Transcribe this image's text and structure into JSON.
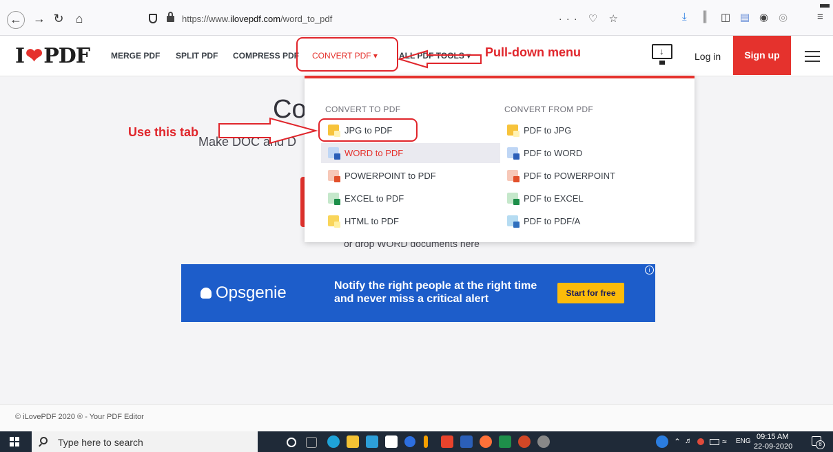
{
  "browser": {
    "url_prefix": "https://www.",
    "url_domain": "ilovepdf.com",
    "url_path": "/word_to_pdf",
    "more_icon": "···",
    "pocket_icon": "♡",
    "star_icon": "☆"
  },
  "site": {
    "logo_left": "I",
    "logo_right": "PDF",
    "menu": [
      "MERGE PDF",
      "SPLIT PDF",
      "COMPRESS PDF",
      "CONVERT PDF ▾",
      "ALL PDF TOOLS ▾"
    ],
    "login": "Log in",
    "signup": "Sign up"
  },
  "dropdown": {
    "to_heading": "CONVERT TO PDF",
    "from_heading": "CONVERT FROM PDF",
    "to_items": [
      "JPG to PDF",
      "WORD to PDF",
      "POWERPOINT to PDF",
      "EXCEL to PDF",
      "HTML to PDF"
    ],
    "from_items": [
      "PDF to JPG",
      "PDF to WORD",
      "PDF to POWERPOINT",
      "PDF to EXCEL",
      "PDF to PDF/A"
    ],
    "active_item": "WORD to PDF"
  },
  "page": {
    "title_visible": "Co",
    "subtitle_visible": "Make DOC and D",
    "drop_text": "or drop WORD documents here"
  },
  "ad": {
    "brand": "Opsgenie",
    "text": "Notify the right people at the right time and never miss a critical alert",
    "cta": "Start for free",
    "info_icon": "i"
  },
  "annotations": {
    "use_tab": "Use this tab",
    "pulldown": "Pull-down menu"
  },
  "footer": {
    "copyright": "© iLovePDF 2020 ® - Your PDF Editor"
  },
  "taskbar": {
    "search_placeholder": "Type here to search",
    "language": "ENG",
    "time": "09:15 AM",
    "date": "22-09-2020",
    "notification_count": "8"
  },
  "colors": {
    "brand_red": "#e5322d",
    "annotation_red": "#e0252b",
    "ad_blue": "#1d5dca",
    "ad_button": "#fcbb0a"
  }
}
